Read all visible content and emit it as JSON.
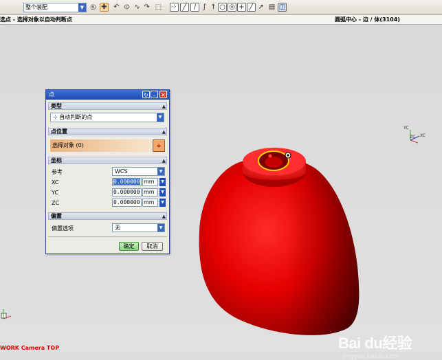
{
  "toolbar": {
    "filter_value": "整个装配",
    "buttons": [
      "assembly-filter",
      "selection-priority",
      "rotate",
      "point-tool",
      "curve",
      "frame-select",
      "snap-point",
      "snap-end",
      "snap-line",
      "snap-curve",
      "snap-up",
      "snap-center",
      "snap-quadrant",
      "snap-intersection",
      "snap-line2",
      "layer",
      "view"
    ]
  },
  "status": {
    "prompt": "选点 - 选择对象以自动判断点",
    "selection_info": "圆弧中心 - 边 / 体(3104)"
  },
  "dialog": {
    "title": "点",
    "sections": {
      "type": {
        "header": "类型",
        "value": "自动判断的点"
      },
      "location": {
        "header": "点位置",
        "select_label": "选择对象 (0)"
      },
      "coords": {
        "header": "坐标",
        "ref_label": "参考",
        "ref_value": "WCS",
        "xc_label": "XC",
        "xc_value": "0.000000",
        "yc_label": "YC",
        "yc_value": "0.000000",
        "zc_label": "ZC",
        "zc_value": "0.000000",
        "unit": "mm"
      },
      "offset": {
        "header": "偏置",
        "option_label": "偏置选项",
        "option_value": "无"
      }
    },
    "ok_label": "确定",
    "cancel_label": "取消"
  },
  "viewport": {
    "camera_label": "WORK Camera TOP",
    "triad_small_labels": [
      "YC",
      "ZC",
      "XC"
    ],
    "watermark_main": "Bai du经验",
    "watermark_sub": "jingyan.baidu.com"
  },
  "colors": {
    "model": "#e00000",
    "highlight": "#ffd200",
    "title_bar": "#1e4cb4"
  }
}
